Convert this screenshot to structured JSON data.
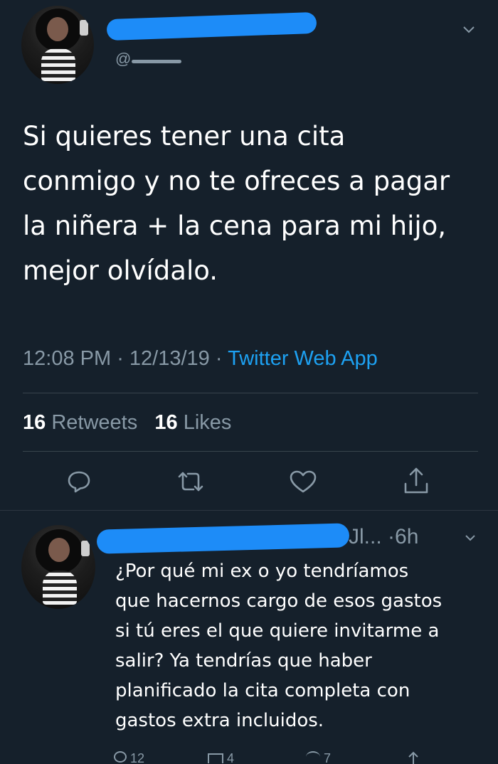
{
  "tweet": {
    "handle_prefix": "@",
    "text": "Si quieres tener una cita\nconmigo y no te ofreces a pagar\nla niñera + la cena para mi hijo,\nmejor olvídalo.",
    "time": "12:08 PM",
    "date": "12/13/19",
    "source": "Twitter Web App",
    "retweets_count": "16",
    "retweets_label": "Retweets",
    "likes_count": "16",
    "likes_label": "Likes",
    "icons": [
      "reply-icon",
      "retweet-icon",
      "like-icon",
      "share-icon"
    ]
  },
  "reply": {
    "handle_tail": "Jl...",
    "age": "6h",
    "text": "¿Por qué mi ex o yo tendríamos\nque hacernos cargo de esos gastos\nsi tú eres el que quiere invitarme a\nsalir? Ya tendrías que haber\nplanificado la cita completa con\ngastos extra incluidos.",
    "reply_count": "12",
    "retweet_count": "4",
    "like_count": "7"
  },
  "colors": {
    "background": "#15202b",
    "text_secondary": "#8899a6",
    "link": "#1da1f2",
    "redaction": "#1d8cf8"
  }
}
